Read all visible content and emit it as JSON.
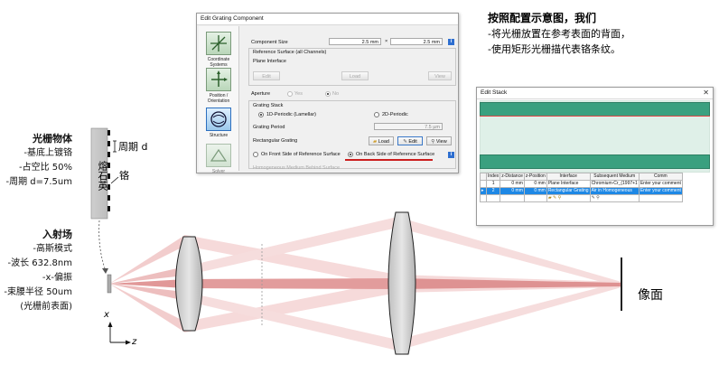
{
  "top_right_note": {
    "title": "按照配置示意图，我们",
    "lines": [
      "-将光栅放置在参考表面的背面，",
      "-使用矩形光栅描代表铬条纹。"
    ]
  },
  "left_annotations": {
    "grating_title": "光栅物体",
    "grating_lines": [
      "-基底上镀铬",
      "-占空比 50%",
      "-周期 d=7.5um"
    ],
    "field_title": "入射场",
    "field_lines": [
      "-高斯模式",
      "-波长 632.8nm",
      "-x-偏振",
      "-束腰半径 50um",
      "(光栅前表面)"
    ]
  },
  "diagram": {
    "substrate_label": "熔石英",
    "period_label": "周期 d",
    "chrome_label": "铬",
    "image_plane_label": "像面",
    "axis_x": "x",
    "axis_z": "z"
  },
  "grating_dialog": {
    "title": "Edit Grating Component",
    "sidebar": [
      "Coordinate Systems",
      "Position / Orientation",
      "Structure",
      "Solver"
    ],
    "component_size_label": "Component Size",
    "size_w": "2.5 mm",
    "size_x": "×",
    "size_h": "2.5 mm",
    "reference_surface_label": "Reference Surface (all Channels)",
    "plane_interface_label": "Plane Interface",
    "btn_edit_disabled": "Edit",
    "btn_load_disabled": "Load",
    "btn_view_disabled": "View",
    "aperture_label": "Aperture",
    "aperture_yes": "Yes",
    "aperture_no": "No",
    "grating_stack_label": "Grating Stack",
    "opt_1d": "1D-Periodic (Lamellar)",
    "opt_2d": "2D-Periodic",
    "grating_period_label": "Grating Period",
    "grating_period_value": "7.5 µm",
    "rect_grating_label": "Rectangular Grating",
    "btn_load": "Load",
    "btn_edit": "Edit",
    "btn_view": "View",
    "front_side": "On Front Side of Reference Surface",
    "back_side": "On Back Side of Reference Surface",
    "homog_medium": "Homogeneous Medium Behind Surface"
  },
  "stack_dialog": {
    "title": "Edit Stack",
    "columns": [
      "",
      "Index",
      "z-Distance",
      "z-Position",
      "Interface",
      "Subsequent Medium",
      "Comm"
    ],
    "rows": [
      {
        "marker": "",
        "index": "1",
        "zdist": "0 mm",
        "zpos": "0 mm",
        "interface": "Plane Interface",
        "medium": "Chromium-Cr_(1997+1",
        "comment": "Enter your comment"
      },
      {
        "marker": "▸",
        "index": "2",
        "zdist": "0 mm",
        "zpos": "0 mm",
        "interface": "Rectangular Grating",
        "medium": "Air in Homogeneous",
        "comment": "Enter your comment"
      }
    ]
  }
}
